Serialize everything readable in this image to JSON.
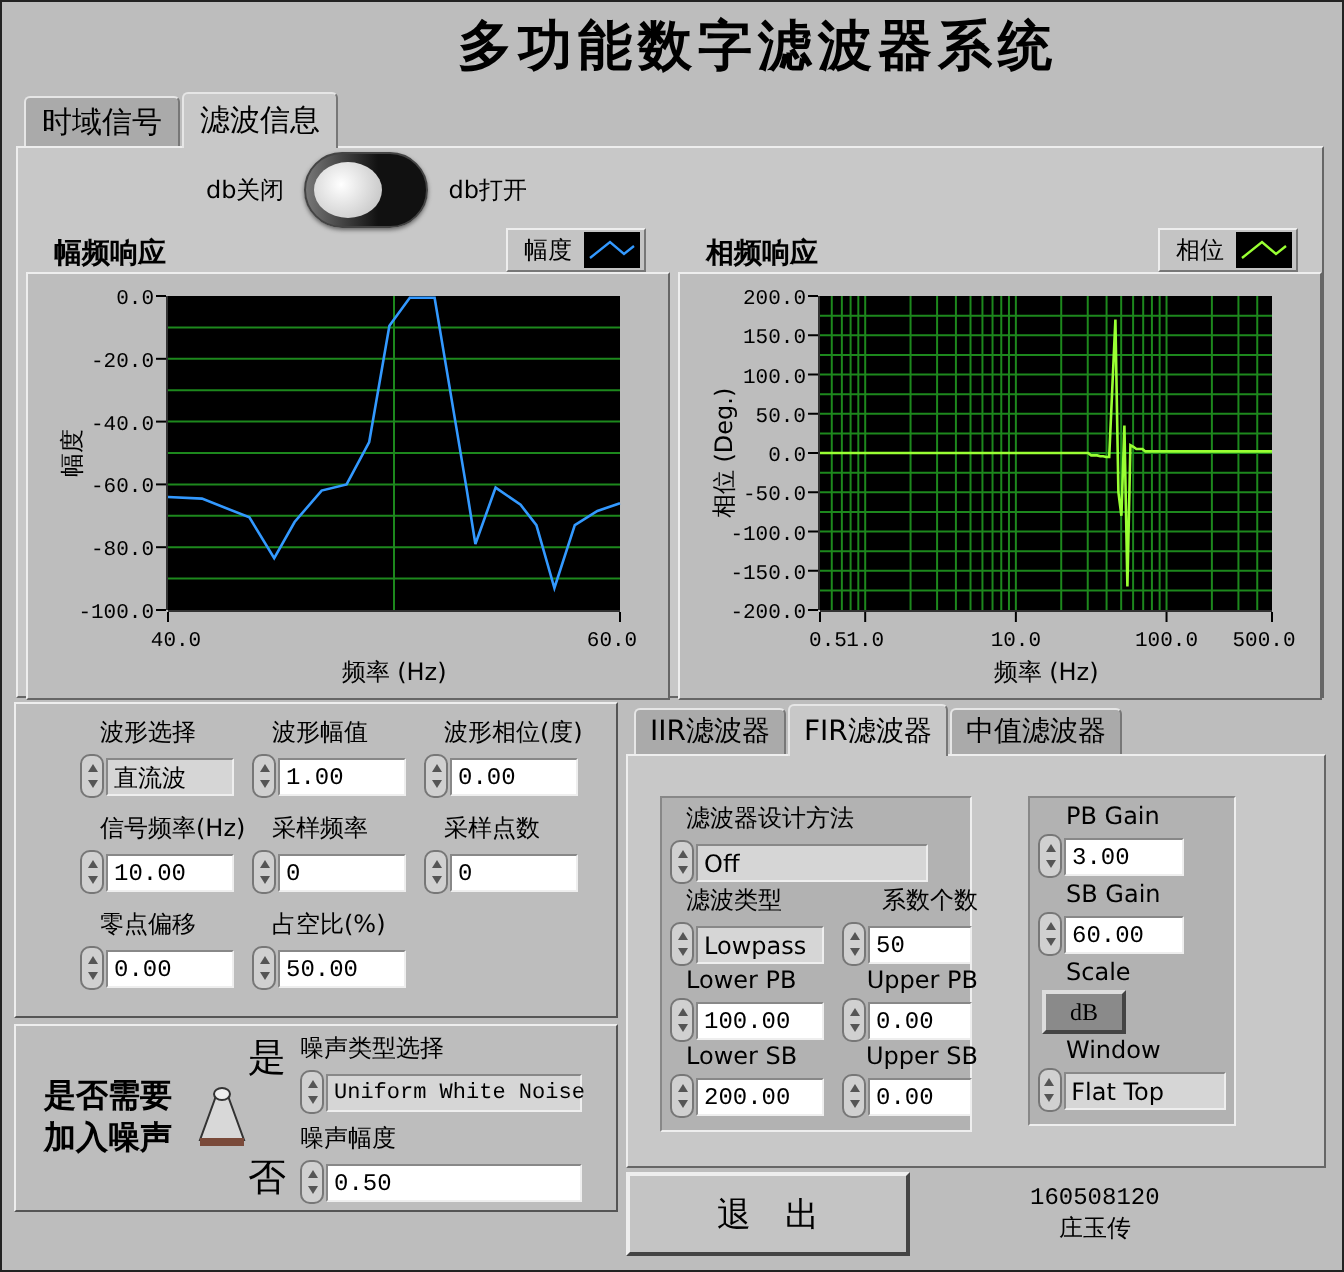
{
  "title": "多功能数字滤波器系统",
  "main_tabs": [
    {
      "label": "时域信号",
      "selected": false
    },
    {
      "label": "滤波信息",
      "selected": true
    }
  ],
  "db_switch": {
    "off_label": "db关闭",
    "on_label": "db打开",
    "on": false
  },
  "graphs": [
    {
      "title": "幅频响应",
      "chart_data": {
        "type": "line",
        "grid": true,
        "xlabel": "频率 (Hz)",
        "ylabel": "幅度",
        "xlim": [
          40,
          60
        ],
        "ylim": [
          -100,
          0
        ],
        "xticks": [
          {
            "value": 40,
            "label": "40.0"
          },
          {
            "value": 60,
            "label": "60.0"
          }
        ],
        "yticks": [
          {
            "value": 0,
            "label": "0.0"
          },
          {
            "value": -20,
            "label": "-20.0"
          },
          {
            "value": -40,
            "label": "-40.0"
          },
          {
            "value": -60,
            "label": "-60.0"
          },
          {
            "value": -80,
            "label": "-80.0"
          },
          {
            "value": -100,
            "label": "-100.0"
          }
        ],
        "x": [
          40,
          41.5,
          43.6,
          44.7,
          45.6,
          46.8,
          47.9,
          48.9,
          49.8,
          50.7,
          51.8,
          53.2,
          53.6,
          54.5,
          55.6,
          56.3,
          57.1,
          58.0,
          59.0,
          60.0
        ],
        "series": [
          {
            "name": "幅度",
            "color": "#3399ff",
            "values": [
              -64,
              -64.5,
              -70.5,
              -83.5,
              -72,
              -62,
              -60,
              -46.5,
              -9.5,
              -0.6,
              -0.6,
              -61,
              -79,
              -61,
              -66.5,
              -73,
              -93,
              -73,
              -68.5,
              -66
            ]
          }
        ]
      }
    },
    {
      "title": "相频响应",
      "chart_data": {
        "type": "line",
        "grid": true,
        "xlabel": "频率 (Hz)",
        "ylabel": "相位 (Deg.)",
        "ylim": [
          -200,
          200
        ],
        "yticks": [
          {
            "value": 200,
            "label": "200.0"
          },
          {
            "value": 150,
            "label": "150.0"
          },
          {
            "value": 100,
            "label": "100.0"
          },
          {
            "value": 50,
            "label": "50.0"
          },
          {
            "value": 0,
            "label": "0.0"
          },
          {
            "value": -50,
            "label": "-50.0"
          },
          {
            "value": -100,
            "label": "-100.0"
          },
          {
            "value": -150,
            "label": "-150.0"
          },
          {
            "value": -200,
            "label": "-200.0"
          }
        ],
        "categories": [
          "0.5",
          null,
          null,
          null,
          null,
          null,
          null,
          null,
          null,
          null,
          null,
          null,
          null,
          null,
          null,
          "1.0",
          null,
          null,
          null,
          null,
          null,
          null,
          null,
          null,
          null,
          null,
          null,
          null,
          null,
          null,
          null,
          null,
          null,
          null,
          null,
          null,
          null,
          null,
          null,
          null,
          null,
          null,
          null,
          null,
          null,
          null,
          null,
          null,
          null,
          null,
          null,
          null,
          null,
          null,
          null,
          null,
          null,
          null,
          null,
          null,
          null,
          null,
          null,
          null,
          null,
          "10.0",
          null,
          null,
          null,
          null,
          null,
          null,
          null,
          null,
          null,
          null,
          null,
          null,
          null,
          null,
          null,
          null,
          null,
          null,
          null,
          null,
          null,
          null,
          null,
          null,
          null,
          null,
          null,
          null,
          null,
          null,
          null,
          null,
          null,
          null,
          null,
          null,
          null,
          null,
          null,
          null,
          null,
          null,
          null,
          null,
          null,
          null,
          null,
          null,
          null,
          "100.0",
          null,
          null,
          null,
          null,
          null,
          null,
          null,
          null,
          null,
          null,
          null,
          null,
          null,
          null,
          null,
          null,
          null,
          null,
          null,
          null,
          null,
          null,
          null,
          null,
          null,
          null,
          null,
          null,
          null,
          null,
          null,
          null,
          null,
          null,
          "500.0"
        ],
        "series": [
          {
            "name": "相位",
            "color": "#99ff33",
            "values": [
              0,
              0,
              0,
              0,
              0,
              0,
              0,
              0,
              0,
              0,
              0,
              0,
              0,
              0,
              0,
              0,
              0,
              0,
              0,
              0,
              0,
              0,
              0,
              0,
              0,
              0,
              0,
              0,
              0,
              0,
              0,
              0,
              0,
              0,
              0,
              0,
              0,
              0,
              0,
              0,
              0,
              0,
              0,
              0,
              0,
              0,
              0,
              0,
              0,
              0,
              0,
              0,
              0,
              0,
              0,
              0,
              0,
              0,
              0,
              0,
              0,
              0,
              0,
              0,
              0,
              0,
              0,
              0,
              0,
              0,
              0,
              0,
              0,
              0,
              0,
              0,
              0,
              0,
              0,
              0,
              0,
              0,
              0,
              0,
              0,
              0,
              0,
              0,
              0,
              0,
              -3,
              -3,
              -3,
              -4,
              -4,
              -5,
              -5,
              80,
              170,
              -50,
              -80,
              35,
              -170,
              10,
              8,
              5,
              5,
              5,
              2,
              2,
              2,
              2,
              2,
              2,
              2,
              2,
              2,
              2,
              2,
              2,
              2,
              2,
              2,
              2,
              2,
              2,
              2,
              2,
              2,
              2,
              2,
              2,
              2,
              2,
              2,
              2,
              2,
              2,
              2,
              2,
              2,
              2,
              2,
              2,
              2,
              2,
              2,
              2,
              2,
              2,
              2
            ]
          }
        ]
      }
    }
  ],
  "signal_controls": [
    {
      "label": "波形选择",
      "kind": "ring",
      "value": "直流波"
    },
    {
      "label": "波形幅值",
      "kind": "numeric",
      "value": "1.00"
    },
    {
      "label": "波形相位(度)",
      "kind": "numeric",
      "value": "0.00"
    },
    {
      "label": "信号频率(Hz)",
      "kind": "numeric",
      "value": "10.00"
    },
    {
      "label": "采样频率",
      "kind": "numeric",
      "value": "0"
    },
    {
      "label": "采样点数",
      "kind": "numeric",
      "value": "0"
    },
    {
      "label": "零点偏移",
      "kind": "numeric",
      "value": "0.00"
    },
    {
      "label": "占空比(%)",
      "kind": "numeric",
      "value": "50.00"
    }
  ],
  "noise": {
    "prompt": "是否需要加入噪声",
    "yes_label": "是",
    "no_label": "否",
    "on": true,
    "controls": [
      {
        "label": "噪声类型选择",
        "kind": "ring",
        "value": "Uniform White Noise"
      },
      {
        "label": "噪声幅度",
        "kind": "numeric",
        "value": "0.50"
      }
    ]
  },
  "filter_tabs": [
    {
      "label": "IIR滤波器",
      "selected": false
    },
    {
      "label": "FIR滤波器",
      "selected": true
    },
    {
      "label": "中值滤波器",
      "selected": false
    }
  ],
  "fir": {
    "method": {
      "label": "滤波器设计方法",
      "kind": "ring",
      "value": "Off"
    },
    "left_controls": [
      {
        "label": "滤波类型",
        "kind": "ring",
        "value": "Lowpass"
      },
      {
        "label": "系数个数",
        "kind": "numeric",
        "value": "50"
      },
      {
        "label": "Lower PB",
        "kind": "numeric",
        "value": "100.00"
      },
      {
        "label": "Upper PB",
        "kind": "numeric",
        "value": "0.00"
      },
      {
        "label": "Lower SB",
        "kind": "numeric",
        "value": "200.00"
      },
      {
        "label": "Upper SB",
        "kind": "numeric",
        "value": "0.00"
      }
    ],
    "right_controls": [
      {
        "label": "PB Gain",
        "kind": "numeric",
        "value": "3.00"
      },
      {
        "label": "SB Gain",
        "kind": "numeric",
        "value": "60.00"
      },
      {
        "label": "Scale",
        "kind": "button",
        "value": "dB"
      },
      {
        "label": "Window",
        "kind": "ring",
        "value": "Flat Top"
      }
    ]
  },
  "exit_button": "退　出",
  "author": {
    "id": "160508120",
    "name": "庄玉传"
  }
}
